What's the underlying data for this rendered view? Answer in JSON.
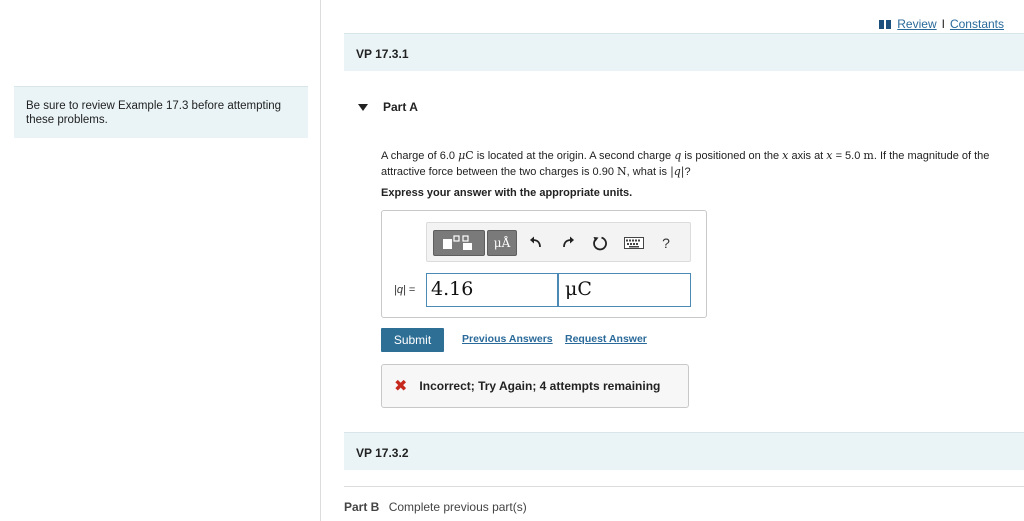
{
  "sidebar": {
    "hint": "Be sure to review Example 17.3 before attempting these problems."
  },
  "header": {
    "review_link": "Review",
    "separator": "I",
    "constants_link": "Constants"
  },
  "sections": {
    "vp1_title": "VP 17.3.1",
    "vp2_title": "VP 17.3.2"
  },
  "partA": {
    "title": "Part A",
    "question": {
      "t1": "A charge of 6.0 ",
      "mu": "μ",
      "C": "C",
      "t2": " is located at the origin. A second charge ",
      "q": "q",
      "t3": " is positioned on the ",
      "x1": "x",
      "t4": " axis at ",
      "x2": "x",
      "t5": " = 5.0 ",
      "m": "m",
      "t6": ". If the magnitude of the attractive force between the two charges is 0.90 ",
      "N": "N",
      "t7": ", what is ",
      "absq": "|q|",
      "t8": "?"
    },
    "instruction": "Express your answer with the appropriate units.",
    "toolbar": {
      "units_label": "μÅ",
      "help_label": "?"
    },
    "answer_label": "|q|",
    "equals": "=",
    "value": "4.16",
    "unit": "μC",
    "submit_label": "Submit",
    "previous_answers": "Previous Answers",
    "request_answer": "Request Answer",
    "feedback": "Incorrect; Try Again; 4 attempts remaining"
  },
  "partB": {
    "label": "Part B",
    "status": "Complete previous part(s)"
  },
  "colors": {
    "accent": "#2e6f96",
    "link": "#2a6a9a",
    "error": "#c6281d",
    "panel": "#eaf4f6"
  }
}
